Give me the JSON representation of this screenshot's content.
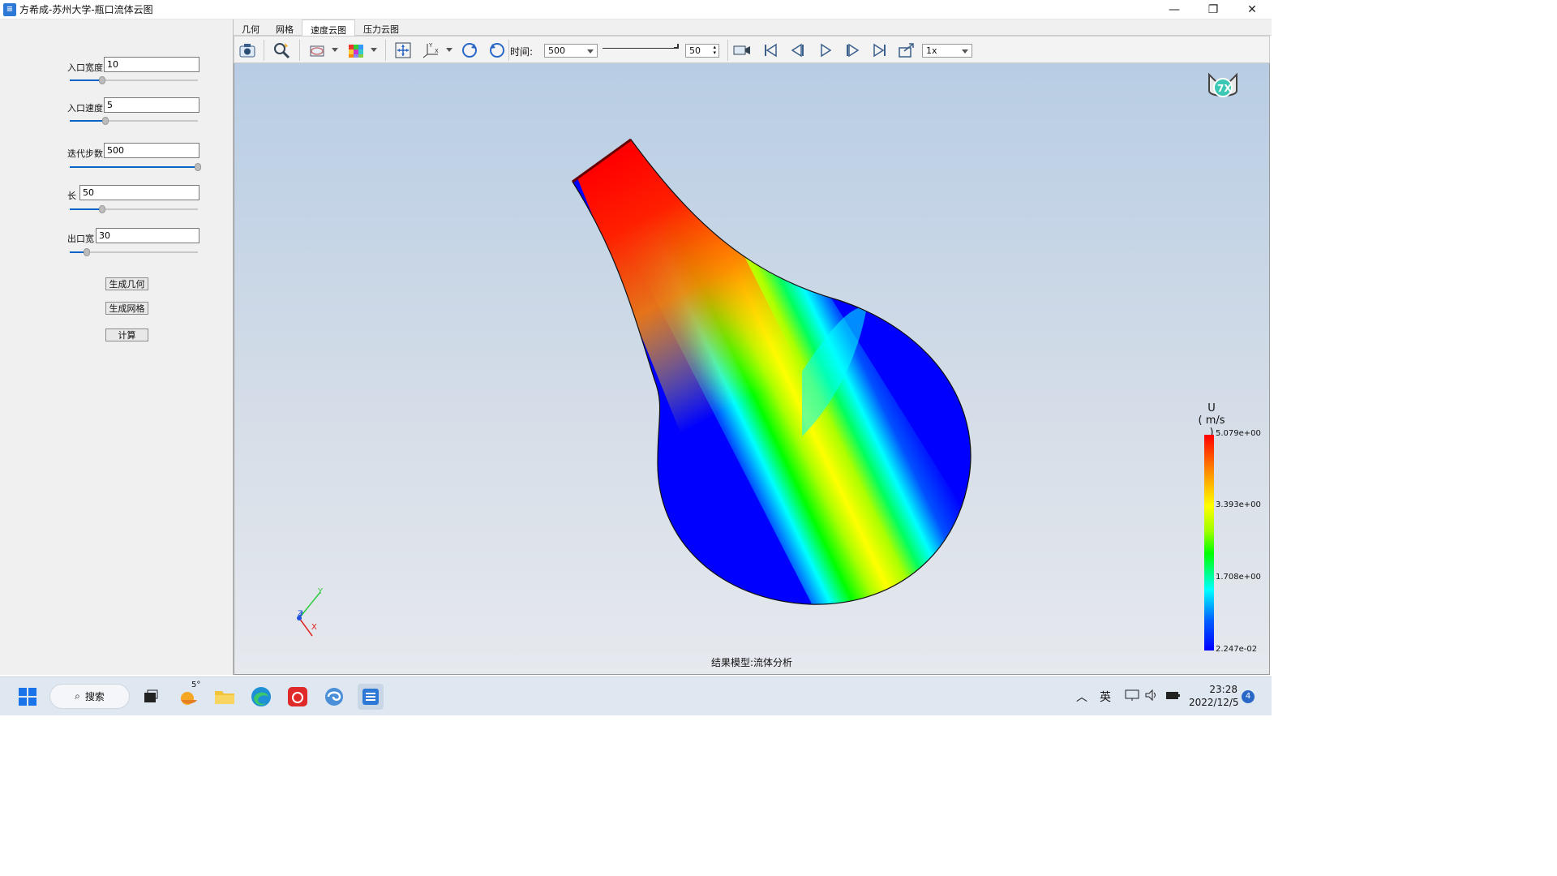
{
  "window": {
    "title": "方希成-苏州大学-瓶口流体云图",
    "app_icon": "app-icon"
  },
  "params": [
    {
      "label": "入口宽度",
      "value": "10",
      "slider_fraction": 0.25
    },
    {
      "label": "入口速度",
      "value": "5",
      "slider_fraction": 0.28
    },
    {
      "label": "迭代步数",
      "value": "500",
      "slider_fraction": 1.0
    },
    {
      "label": "长",
      "value": "50",
      "slider_fraction": 0.25
    },
    {
      "label": "出口宽",
      "value": "30",
      "slider_fraction": 0.13
    }
  ],
  "buttons": {
    "gen_geometry": "生成几何",
    "gen_mesh": "生成网格",
    "compute": "计算"
  },
  "tabs": [
    "几何",
    "网格",
    "速度云图",
    "压力云图"
  ],
  "active_tab": "速度云图",
  "toolbar": {
    "time_label": "时间:",
    "time_value": "500",
    "frame_value": "50",
    "speed_value": "1x",
    "icons": [
      "camera-icon",
      "zoom-icon",
      "display-mode-icon",
      "colormap-icon",
      "fit-view-icon",
      "axes-icon",
      "rotate-cw-icon",
      "rotate-ccw-icon",
      "record-icon",
      "first-frame-icon",
      "prev-frame-icon",
      "play-icon",
      "next-frame-icon",
      "last-frame-icon",
      "export-icon"
    ]
  },
  "viewport": {
    "status": "结果模型:流体分析",
    "legend": {
      "title": "U",
      "unit": "( m/s )",
      "max": "5.079e+00",
      "v2": "3.393e+00",
      "v3": "1.708e+00",
      "min": "2.247e-02"
    },
    "axes": {
      "x": "X",
      "y": "Y",
      "z": "Z"
    }
  },
  "taskbar": {
    "search_label": "搜索",
    "weather": "5°",
    "ime": "英",
    "time": "23:28",
    "date": "2022/12/5",
    "notifications": "4",
    "colors": {
      "accent": "#2a68c8"
    }
  }
}
